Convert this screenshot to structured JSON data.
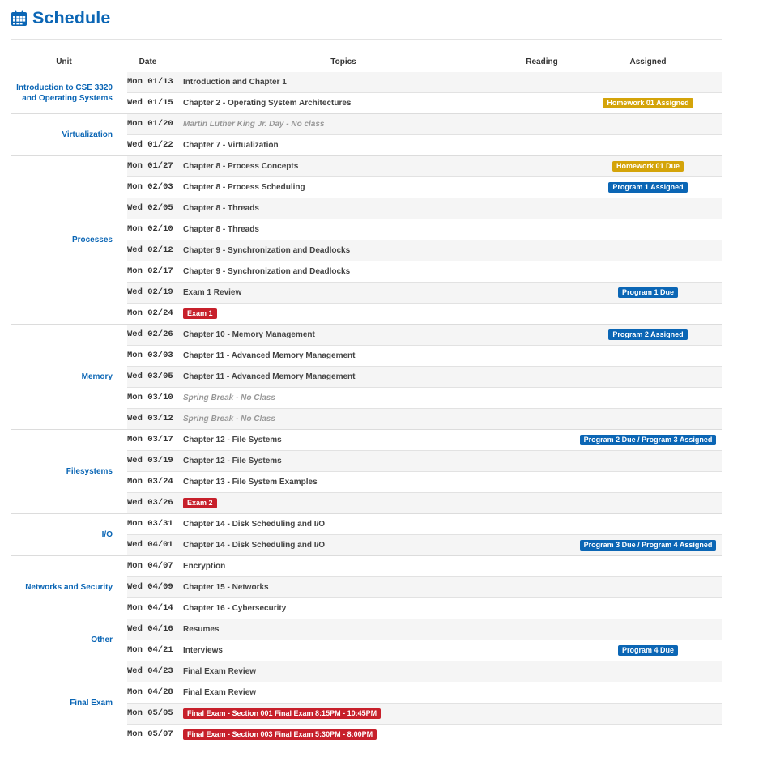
{
  "page_title": "Schedule",
  "headers": {
    "unit": "Unit",
    "date": "Date",
    "topics": "Topics",
    "reading": "Reading",
    "assigned": "Assigned"
  },
  "colors": {
    "accent": "#0b66b5",
    "badge_yellow": "#d4a40a",
    "badge_blue": "#0b66b5",
    "badge_red": "#c7202b"
  },
  "icons": {
    "title_icon": "calendar-icon"
  },
  "groups": [
    {
      "unit": "Introduction to CSE 3320 and Operating Systems",
      "rows": [
        {
          "date": "Mon 01/13",
          "topic": "Introduction and Chapter 1"
        },
        {
          "date": "Wed 01/15",
          "topic": "Chapter 2 - Operating System Architectures",
          "assigned": "Homework 01 Assigned",
          "assigned_color": "yellow"
        }
      ]
    },
    {
      "unit": "Virtualization",
      "rows": [
        {
          "date": "Mon 01/20",
          "topic": "Martin Luther King Jr. Day - No class",
          "muted": true
        },
        {
          "date": "Wed 01/22",
          "topic": "Chapter 7 - Virtualization"
        }
      ]
    },
    {
      "unit": "Processes",
      "rows": [
        {
          "date": "Mon 01/27",
          "topic": "Chapter 8 - Process Concepts",
          "assigned": "Homework 01 Due",
          "assigned_color": "yellow"
        },
        {
          "date": "Mon 02/03",
          "topic": "Chapter 8 - Process Scheduling",
          "assigned": "Program 1 Assigned",
          "assigned_color": "blue"
        },
        {
          "date": "Wed 02/05",
          "topic": "Chapter 8 - Threads"
        },
        {
          "date": "Mon 02/10",
          "topic": "Chapter 8 - Threads"
        },
        {
          "date": "Wed 02/12",
          "topic": "Chapter 9 - Synchronization and Deadlocks"
        },
        {
          "date": "Mon 02/17",
          "topic": "Chapter 9 - Synchronization and Deadlocks"
        },
        {
          "date": "Wed 02/19",
          "topic": "Exam 1 Review",
          "assigned": "Program 1 Due",
          "assigned_color": "blue"
        },
        {
          "date": "Mon 02/24",
          "topic_badge": "Exam 1"
        }
      ]
    },
    {
      "unit": "Memory",
      "rows": [
        {
          "date": "Wed 02/26",
          "topic": "Chapter 10 - Memory Management",
          "assigned": "Program 2 Assigned",
          "assigned_color": "blue"
        },
        {
          "date": "Mon 03/03",
          "topic": "Chapter 11 - Advanced Memory Management"
        },
        {
          "date": "Wed 03/05",
          "topic": "Chapter 11 - Advanced Memory Management"
        },
        {
          "date": "Mon 03/10",
          "topic": "Spring Break - No Class",
          "muted": true
        },
        {
          "date": "Wed 03/12",
          "topic": "Spring Break - No Class",
          "muted": true
        }
      ]
    },
    {
      "unit": "Filesystems",
      "rows": [
        {
          "date": "Mon 03/17",
          "topic": "Chapter 12 - File Systems",
          "assigned": "Program 2 Due / Program 3 Assigned",
          "assigned_color": "blue"
        },
        {
          "date": "Wed 03/19",
          "topic": "Chapter 12 - File Systems"
        },
        {
          "date": "Mon 03/24",
          "topic": "Chapter 13 - File System Examples"
        },
        {
          "date": "Wed 03/26",
          "topic_badge": "Exam 2"
        }
      ]
    },
    {
      "unit": "I/O",
      "rows": [
        {
          "date": "Mon 03/31",
          "topic": "Chapter 14 - Disk Scheduling and I/O"
        },
        {
          "date": "Wed 04/01",
          "topic": "Chapter 14 - Disk Scheduling and I/O",
          "assigned": "Program 3 Due / Program 4 Assigned",
          "assigned_color": "blue"
        }
      ]
    },
    {
      "unit": "Networks and Security",
      "rows": [
        {
          "date": "Mon 04/07",
          "topic": "Encryption"
        },
        {
          "date": "Wed 04/09",
          "topic": "Chapter 15 - Networks"
        },
        {
          "date": "Mon 04/14",
          "topic": "Chapter 16 - Cybersecurity"
        }
      ]
    },
    {
      "unit": "Other",
      "rows": [
        {
          "date": "Wed 04/16",
          "topic": "Resumes"
        },
        {
          "date": "Mon 04/21",
          "topic": "Interviews",
          "assigned": "Program 4 Due",
          "assigned_color": "blue"
        }
      ]
    },
    {
      "unit": "Final Exam",
      "rows": [
        {
          "date": "Wed 04/23",
          "topic": "Final Exam Review"
        },
        {
          "date": "Mon 04/28",
          "topic": "Final Exam Review"
        },
        {
          "date": "Mon 05/05",
          "topic_badge": "Final Exam - Section 001 Final Exam 8:15PM - 10:45PM"
        },
        {
          "date": "Mon 05/07",
          "topic_badge": "Final Exam - Section 003 Final Exam 5:30PM - 8:00PM"
        }
      ]
    }
  ]
}
